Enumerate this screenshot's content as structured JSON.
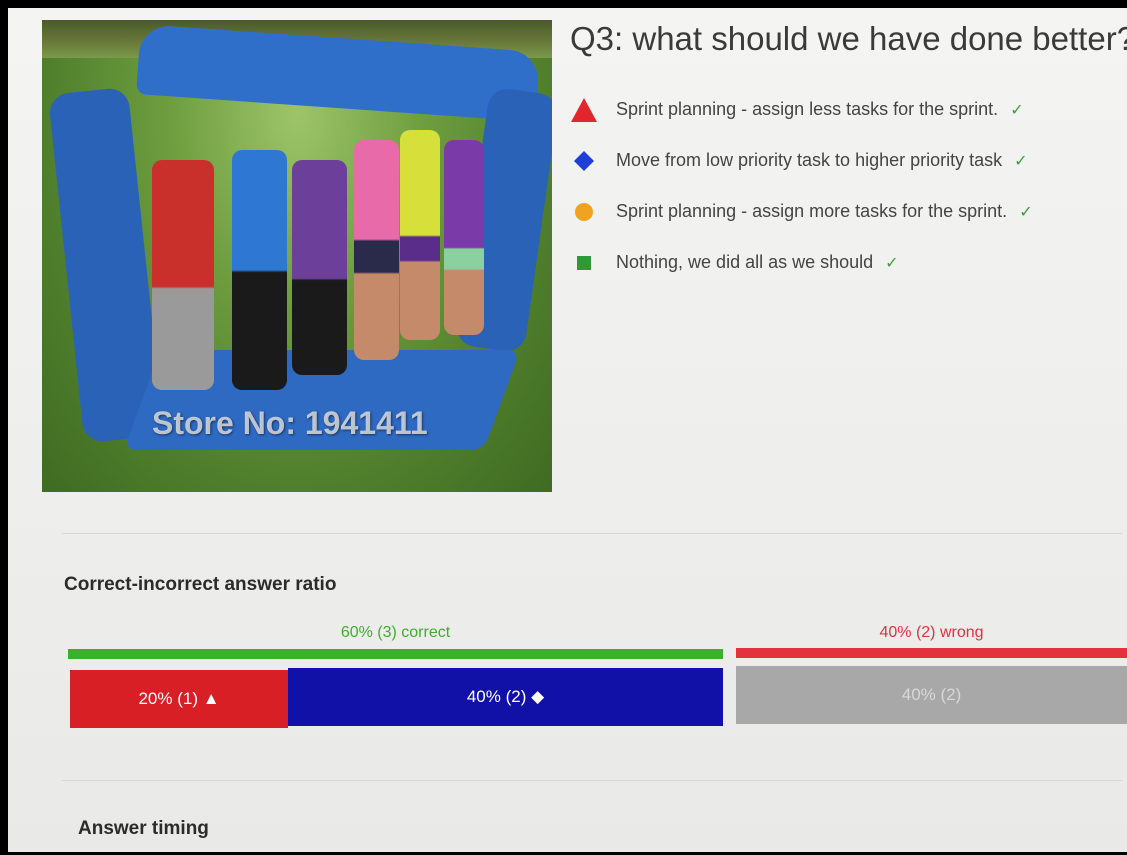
{
  "image": {
    "watermark": "Store No: 1941411"
  },
  "question": {
    "title": "Q3: what should we have done better?"
  },
  "answers": [
    {
      "text": "Sprint planning - assign less tasks for the sprint.",
      "shape": "triangle-icon",
      "color": "#e3262d",
      "check": "✓"
    },
    {
      "text": "Move from low priority task to higher priority task",
      "shape": "diamond-icon",
      "color": "#1f3fd6",
      "check": "✓"
    },
    {
      "text": "Sprint planning - assign more tasks for the sprint.",
      "shape": "circle-icon",
      "color": "#f0a321",
      "check": "✓"
    },
    {
      "text": "Nothing, we did all as we should",
      "shape": "square-icon",
      "color": "#2e9a37",
      "check": "✓"
    }
  ],
  "ratio": {
    "title": "Correct-incorrect answer ratio",
    "correct_label": "60% (3) correct",
    "wrong_label": "40% (2) wrong",
    "correct_color": "#3fae2e",
    "wrong_color": "#e3323d",
    "segments": [
      {
        "label": "20% (1) ▲",
        "percent": 20,
        "color": "#d81f26"
      },
      {
        "label": "40% (2) ◆",
        "percent": 40,
        "color": "#1111a8"
      },
      {
        "label": "40% (2)",
        "percent": 40,
        "color": "#a8a8a8"
      }
    ]
  },
  "timing": {
    "title": "Answer timing"
  }
}
